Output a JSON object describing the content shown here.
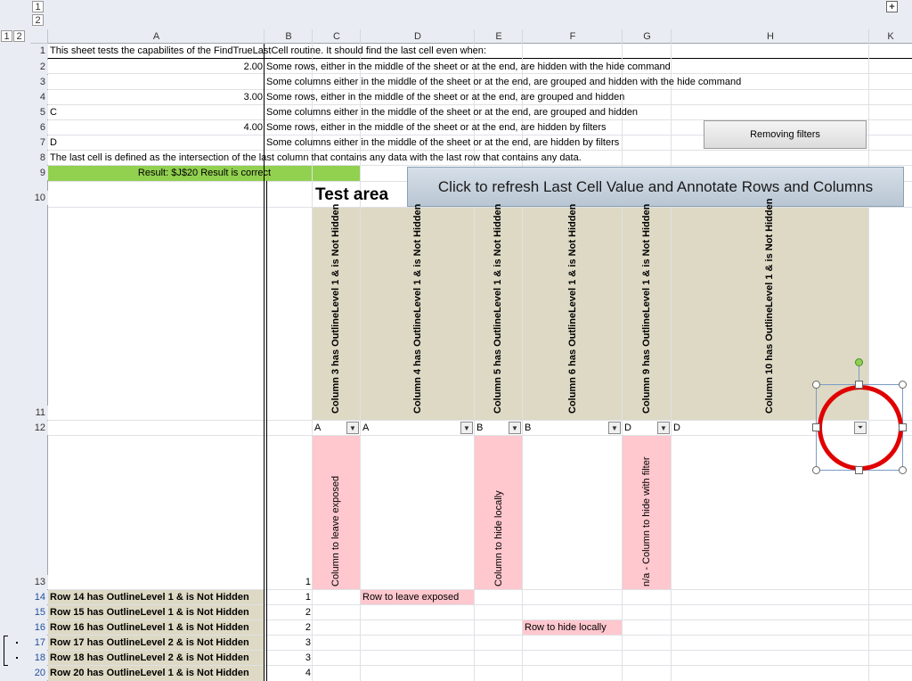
{
  "outline": {
    "level_buttons_top": [
      "1",
      "2"
    ],
    "level_buttons_left": [
      "1",
      "2"
    ],
    "expand_symbol": "+"
  },
  "columns": [
    "A",
    "B",
    "C",
    "D",
    "E",
    "F",
    "G",
    "H",
    "K"
  ],
  "rows": [
    "1",
    "2",
    "3",
    "4",
    "5",
    "6",
    "7",
    "8",
    "9",
    "10",
    "11",
    "12",
    "13",
    "14",
    "15",
    "16",
    "17",
    "18",
    "20"
  ],
  "intro": {
    "r1": "This sheet tests the capabilites of the FindTrueLastCell routine. It should find the last cell even when:",
    "r2_num": "2.00",
    "r2_text": "Some rows, either in the middle of the sheet or at the end, are hidden with the hide command",
    "r3_text": "Some columns either in the middle of the sheet or at the end, are grouped and hidden with the hide command",
    "r4_num": "3.00",
    "r4_text": "Some rows, either in the middle of the sheet or at the end, are grouped and hidden",
    "r5_a": "C",
    "r5_text": "Some columns either in the middle of the sheet or at the end, are grouped and hidden",
    "r6_num": "4.00",
    "r6_text": "Some rows, either in the middle of the sheet or at the end, are hidden by filters",
    "r7_a": "D",
    "r7_text": "Some columns either in the middle of the sheet or at the end, are hidden by filters",
    "r8": "The last cell is defined as the intersection of the last column that contains any data with the last row that contains any data.",
    "r9_result": "Result: $J$20 Result is correct"
  },
  "buttons": {
    "removing_filters": "Removing filters",
    "refresh": "Click to refresh Last Cell Value and Annotate Rows and Columns"
  },
  "test_area": "Test area",
  "col_annotations": [
    "Column 3 has OutlineLevel 1 & is Not Hidden",
    "Column 4 has OutlineLevel 1 & is Not Hidden",
    "Column 5 has OutlineLevel 1 & is Not Hidden",
    "Column 6 has OutlineLevel 1 & is Not Hidden",
    "Column 9 has OutlineLevel 1 & is Not Hidden",
    "Column 10 has OutlineLevel 1 & is Not Hidden"
  ],
  "filter_row": [
    "A",
    "A",
    "B",
    "B",
    "D",
    "D"
  ],
  "row13": {
    "c": "Column to leave exposed",
    "e": "Column to hide locally",
    "g": "n/a - Column to hide with filter",
    "b": "1"
  },
  "data_rows": [
    {
      "label": "Row 14 has OutlineLevel 1 & is Not Hidden",
      "b": "1",
      "note": "Row to leave exposed"
    },
    {
      "label": "Row 15 has OutlineLevel 1 & is Not Hidden",
      "b": "2",
      "note": ""
    },
    {
      "label": "Row 16 has OutlineLevel 1 & is Not Hidden",
      "b": "2",
      "note": "Row to hide locally"
    },
    {
      "label": "Row 17 has OutlineLevel 2 & is Not Hidden",
      "b": "3",
      "note": ""
    },
    {
      "label": "Row 18 has OutlineLevel 2 & is Not Hidden",
      "b": "3",
      "note": ""
    },
    {
      "label": "Row 20 has OutlineLevel 1 & is Not Hidden",
      "b": "4",
      "note": ""
    }
  ],
  "colors": {
    "green": "#92d050",
    "tan": "#ddd9c4",
    "pink": "#ffc7ce",
    "header": "#e9ecf2",
    "circle": "#e00000"
  }
}
